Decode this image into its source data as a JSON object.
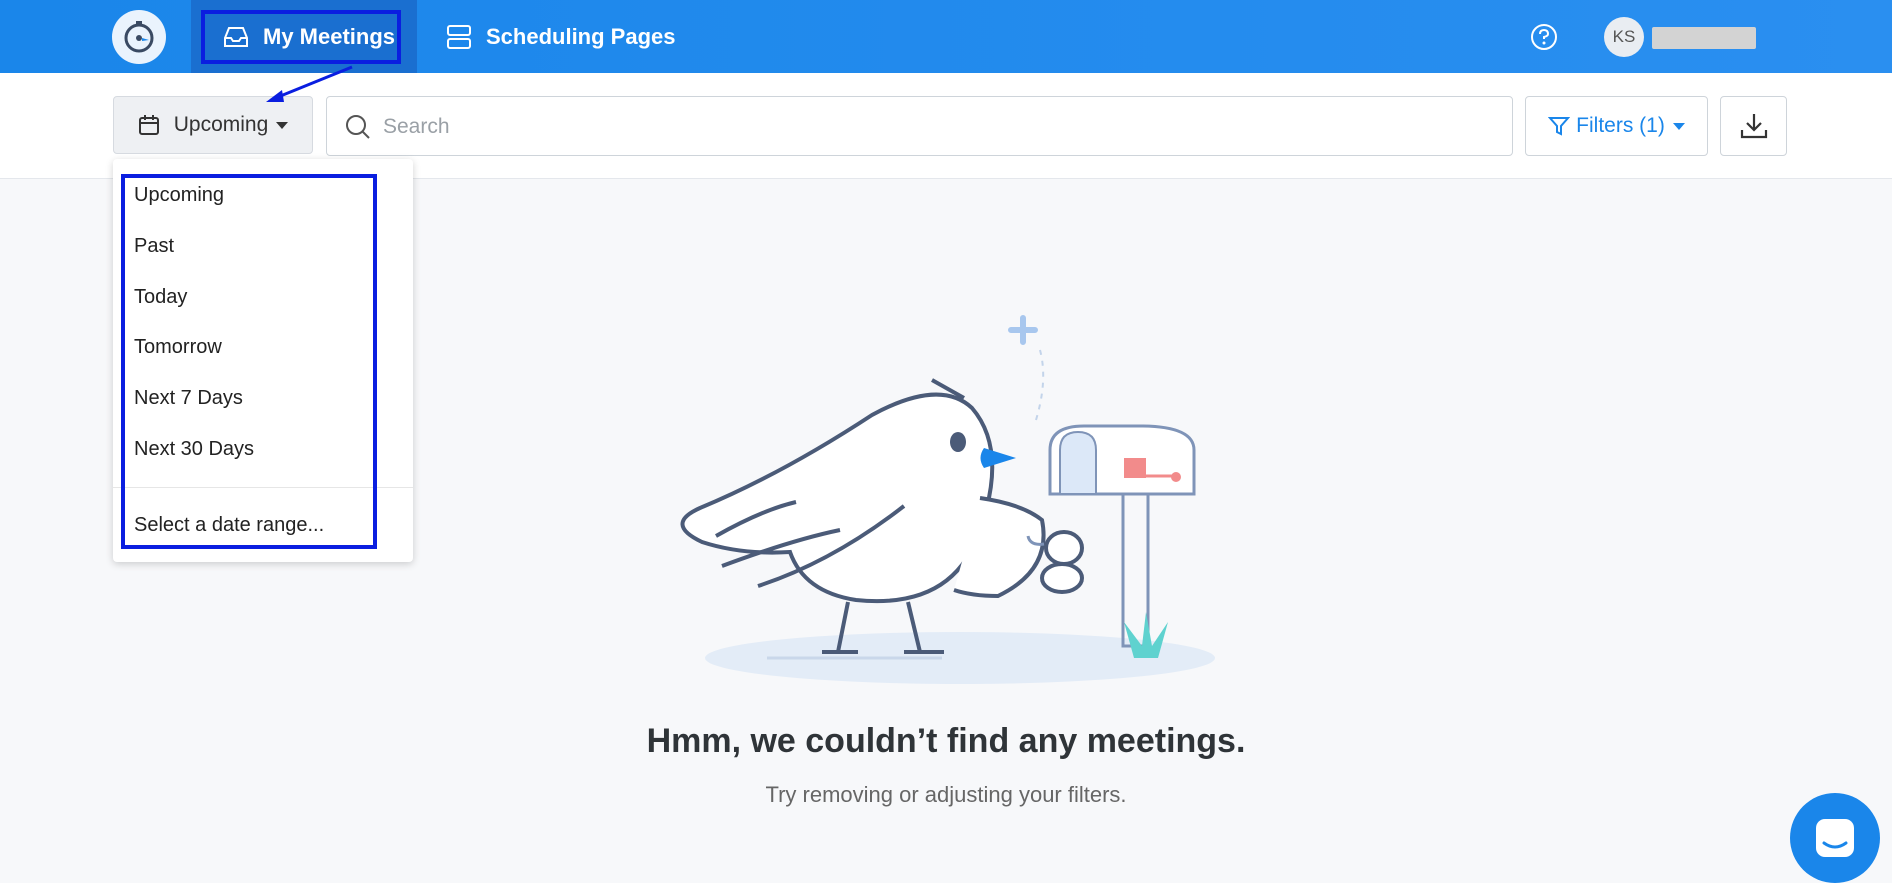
{
  "topbar": {
    "nav": [
      {
        "label": "My Meetings",
        "icon": "inbox-icon",
        "active": true
      },
      {
        "label": "Scheduling Pages",
        "icon": "server-icon",
        "active": false
      }
    ],
    "avatar_initials": "KS"
  },
  "toolbar": {
    "period_label": "Upcoming",
    "search_placeholder": "Search",
    "filters_label": "Filters (1)"
  },
  "period_menu": {
    "items": [
      "Upcoming",
      "Past",
      "Today",
      "Tomorrow",
      "Next 7 Days",
      "Next 30 Days"
    ],
    "range_label": "Select a date range..."
  },
  "empty_state": {
    "title": "Hmm, we couldn’t find any meetings.",
    "subtitle": "Try removing or adjusting your filters."
  },
  "colors": {
    "brand_blue": "#1a86ea",
    "annotation_blue": "#0a1ee0"
  }
}
